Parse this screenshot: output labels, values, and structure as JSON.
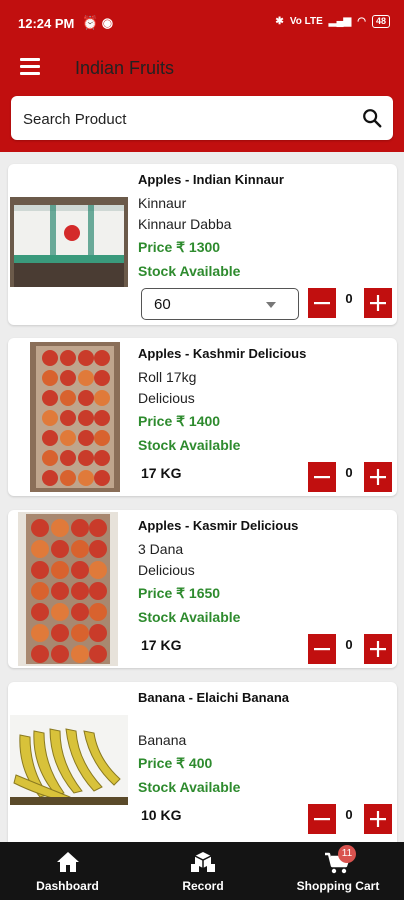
{
  "status": {
    "time": "12:24 PM",
    "battery": "48",
    "network": "Vo LTE"
  },
  "header": {
    "title": "Indian Fruits"
  },
  "search": {
    "placeholder": "Search Product"
  },
  "products": [
    {
      "name": "Apples - Indian Kinnaur",
      "line1": "Kinnaur",
      "line2": "Kinnaur Dabba",
      "price": "Price  ₹ 1300",
      "stock": "Stock Available",
      "quantity_option": "60",
      "count": "0"
    },
    {
      "name": "Apples - Kashmir Delicious",
      "line1": "Roll  17kg",
      "line2": "Delicious",
      "price": "Price  ₹ 1400",
      "stock": "Stock Available",
      "unit": "17 KG",
      "count": "0"
    },
    {
      "name": "Apples - Kasmir Delicious",
      "line1": "3 Dana",
      "line2": "Delicious",
      "price": "Price  ₹ 1650",
      "stock": "Stock Available",
      "unit": "17 KG",
      "count": "0"
    },
    {
      "name": "Banana - Elaichi Banana",
      "line1": "Banana",
      "price": "Price  ₹ 400",
      "stock": "Stock Available",
      "unit": "10 KG",
      "count": "0"
    }
  ],
  "nav": {
    "dashboard": "Dashboard",
    "record": "Record",
    "cart": "Shopping Cart",
    "cart_badge": "11"
  },
  "colors": {
    "brand": "#c10f0f",
    "stock": "#2e8b2e",
    "bottom_bar": "#141414",
    "badge": "#d9534f"
  }
}
